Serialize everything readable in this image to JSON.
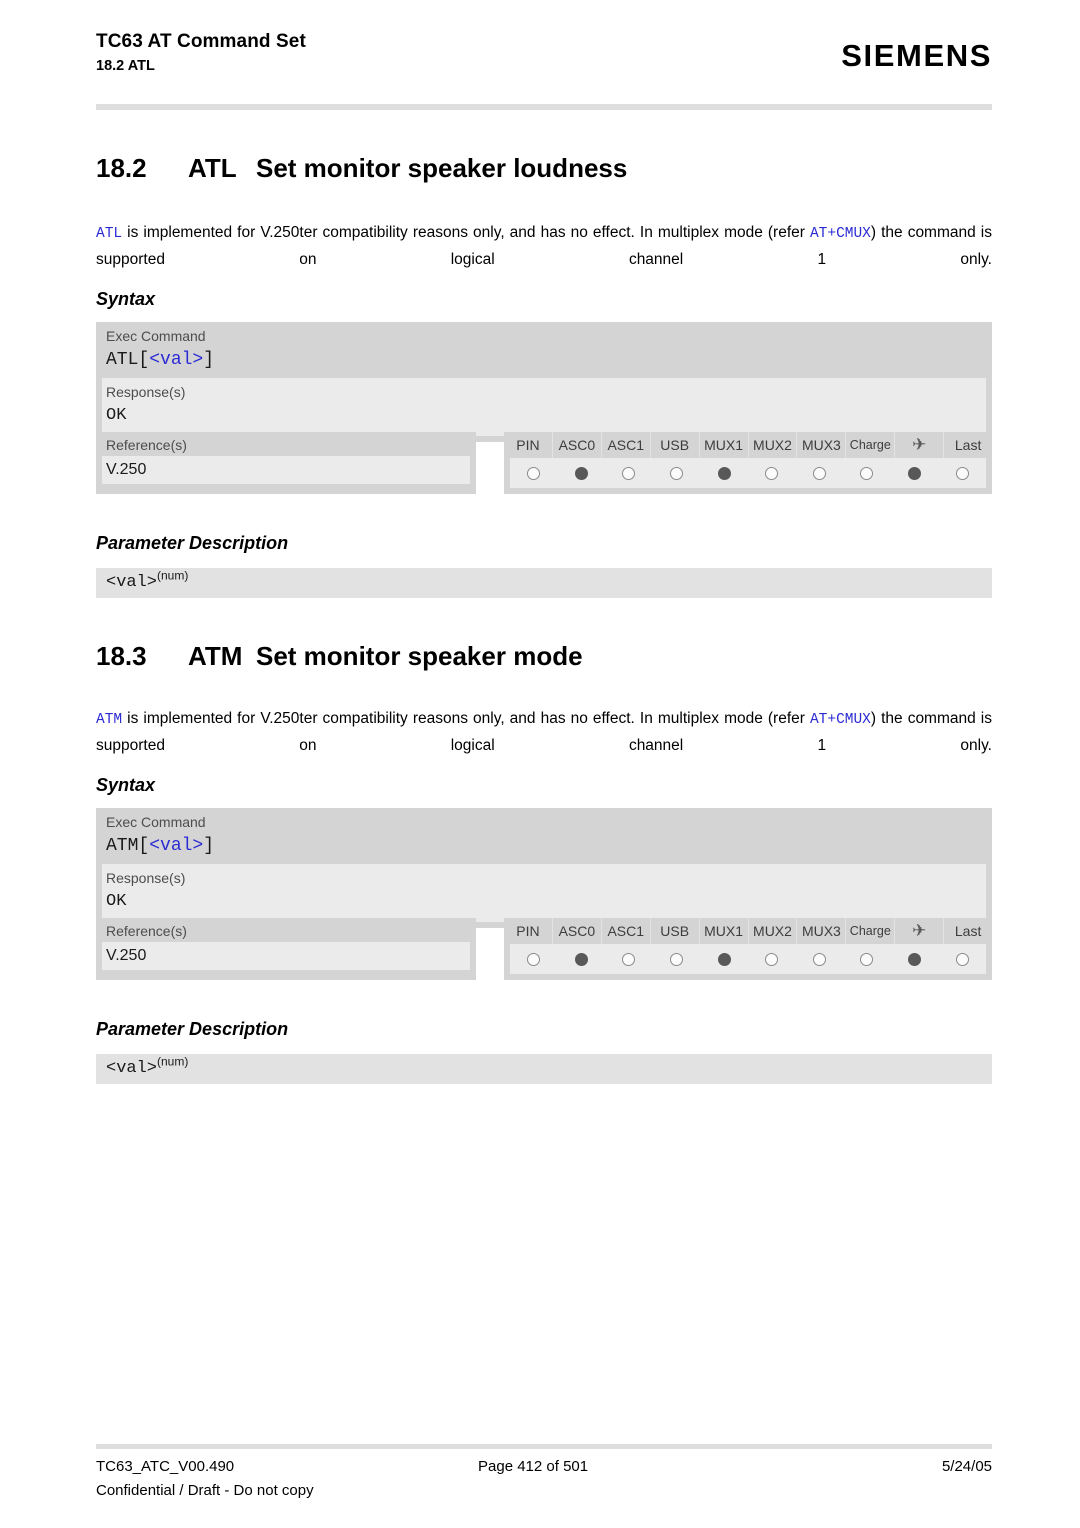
{
  "header": {
    "doc_title": "TC63 AT Command Set",
    "section_ref": "18.2 ATL",
    "logo": "SIEMENS"
  },
  "sections": [
    {
      "number": "18.2",
      "command": "ATL",
      "title": "Set monitor speaker loudness",
      "intro": {
        "cmd1": "ATL",
        "text1": " is implemented for V.250ter compatibility reasons only, and has no effect. In multiplex mode (refer ",
        "cmd2": "AT+CMUX",
        "text2": ") the command is supported on logical channel 1 only."
      },
      "syntax_heading": "Syntax",
      "syntax": {
        "exec_label": "Exec Command",
        "exec_code_prefix": "ATL[",
        "exec_code_param": "<val>",
        "exec_code_suffix": "]",
        "response_label": "Response(s)",
        "response_value": "OK"
      },
      "reference": {
        "label": "Reference(s)",
        "value": "V.250"
      },
      "support_table": {
        "columns": [
          "PIN",
          "ASC0",
          "ASC1",
          "USB",
          "MUX1",
          "MUX2",
          "MUX3",
          "Charge",
          "✈",
          "Last"
        ],
        "values": [
          false,
          true,
          false,
          false,
          true,
          false,
          false,
          false,
          true,
          false
        ]
      },
      "param_heading": "Parameter Description",
      "param": {
        "name": "<val>",
        "sup": "(num)"
      }
    },
    {
      "number": "18.3",
      "command": "ATM",
      "title": "Set monitor speaker mode",
      "intro": {
        "cmd1": "ATM",
        "text1": " is implemented for V.250ter compatibility reasons only, and has no effect. In multiplex mode (refer ",
        "cmd2": "AT+CMUX",
        "text2": ") the command is supported on logical channel 1 only."
      },
      "syntax_heading": "Syntax",
      "syntax": {
        "exec_label": "Exec Command",
        "exec_code_prefix": "ATM[",
        "exec_code_param": "<val>",
        "exec_code_suffix": "]",
        "response_label": "Response(s)",
        "response_value": "OK"
      },
      "reference": {
        "label": "Reference(s)",
        "value": "V.250"
      },
      "support_table": {
        "columns": [
          "PIN",
          "ASC0",
          "ASC1",
          "USB",
          "MUX1",
          "MUX2",
          "MUX3",
          "Charge",
          "✈",
          "Last"
        ],
        "values": [
          false,
          true,
          false,
          false,
          true,
          false,
          false,
          false,
          true,
          false
        ]
      },
      "param_heading": "Parameter Description",
      "param": {
        "name": "<val>",
        "sup": "(num)"
      }
    }
  ],
  "footer": {
    "doc_id": "TC63_ATC_V00.490",
    "confidential": "Confidential / Draft - Do not copy",
    "page": "Page 412 of 501",
    "date": "5/24/05"
  }
}
